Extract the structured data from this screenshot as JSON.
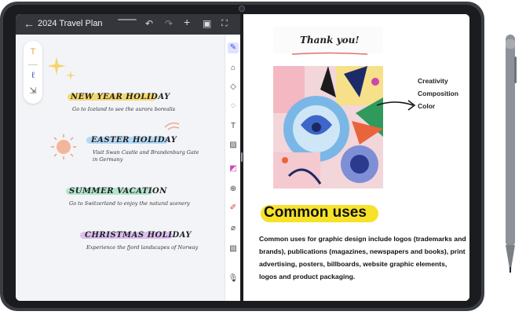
{
  "app": {
    "title": "2024 Travel Plan"
  },
  "toolbar": {
    "back_icon": "back-arrow-icon",
    "undo_icon": "undo-icon",
    "redo_icon": "redo-icon",
    "add_icon": "add-icon",
    "layout_icon": "split-view-icon",
    "fullscreen_icon": "fullscreen-icon"
  },
  "holidays": [
    {
      "title": "NEW YEAR HOLIDAY",
      "desc": "Go to Iceland to see the aurora borealis",
      "color": "#f2d25a"
    },
    {
      "title": "EASTER HOLIDAY",
      "desc": "Visit Swan Castle and Brandenburg Gate in Germany",
      "color": "#a9d3f5"
    },
    {
      "title": "SUMMER VACATION",
      "desc": "Go to Switzerland to enjoy the natural scenery",
      "color": "#a8e0c6"
    },
    {
      "title": "CHRISTMAS HOLIDAY",
      "desc": "Experience the fjord landscapes of Norway",
      "color": "#d6b6ee"
    }
  ],
  "right": {
    "thanks": "Thank you!",
    "annotations": [
      "Creativity",
      "Composition",
      "Color"
    ],
    "heading": "Common uses",
    "body": "Common uses for graphic design include logos (trademarks and brands), publications (magazines, newspapers and books), print advertising, posters, billboards, website graphic elements, logos and product packaging."
  },
  "colors": {
    "accent": "#3b4ccf",
    "highlight_yellow": "#f7e22a"
  }
}
